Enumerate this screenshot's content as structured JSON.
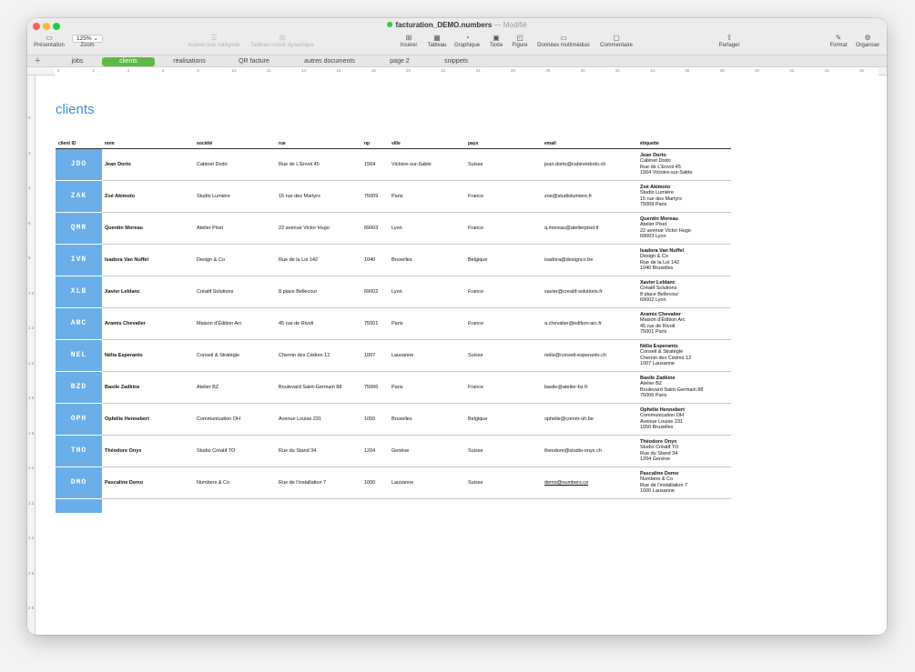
{
  "window": {
    "title": "facturation_DEMO.numbers",
    "modified": "— Modifié"
  },
  "toolbar": {
    "left": [
      {
        "label": "Présentation",
        "icon": "sidebar-icon"
      },
      {
        "label": "Zoom",
        "value": "125%"
      }
    ],
    "center_disabled": [
      {
        "label": "Insérer une catégorie",
        "icon": "list-icon"
      },
      {
        "label": "Tableau croisé dynamique",
        "icon": "pivot-icon"
      }
    ],
    "center": [
      {
        "label": "Insérer",
        "icon": "plus-box-icon"
      },
      {
        "label": "Tableau",
        "icon": "table-icon"
      },
      {
        "label": "Graphique",
        "icon": "chart-icon"
      },
      {
        "label": "Texte",
        "icon": "text-box-icon"
      },
      {
        "label": "Figure",
        "icon": "shape-icon"
      },
      {
        "label": "Données multimédias",
        "icon": "media-icon"
      },
      {
        "label": "Commentaire",
        "icon": "comment-icon"
      }
    ],
    "share": {
      "label": "Partager",
      "icon": "share-icon"
    },
    "right": [
      {
        "label": "Format",
        "icon": "brush-icon"
      },
      {
        "label": "Organiser",
        "icon": "organize-icon"
      }
    ]
  },
  "tabs": [
    "jobs",
    "clients",
    "réalisations",
    "QR facture",
    "autres documents",
    "page 2",
    "snippets"
  ],
  "active_tab": "clients",
  "ruler": [
    "0",
    "2",
    "4",
    "6",
    "8",
    "10",
    "12",
    "14",
    "16",
    "18",
    "20",
    "22",
    "24",
    "26",
    "28",
    "30",
    "32",
    "34",
    "36",
    "38",
    "40",
    "42",
    "44",
    "46"
  ],
  "vruler": [
    "0",
    "2",
    "4",
    "6",
    "8",
    "1 0",
    "1 2",
    "1 4",
    "1 6",
    "1 8",
    "2 0",
    "2 2",
    "2 4",
    "2 6",
    "2 8",
    "3"
  ],
  "sheet": {
    "title": "clients",
    "columns": [
      "client ID",
      "nom",
      "société",
      "rue",
      "np",
      "ville",
      "pays",
      "email",
      "étiquette"
    ],
    "rows": [
      {
        "id": "JDO",
        "nom": "Jean Dorto",
        "societe": "Cabinet Dodo",
        "rue": "Rue de L'Envol 45",
        "np": "1564",
        "ville": "Victoire-sur-Sable",
        "pays": "Suisse",
        "email": "jean.dorto@cabinetdodo.ch",
        "etiquette": [
          "Jean Dorto",
          "Cabinet Dodo",
          "Rue de L'Envol 45",
          "1564 Victoire-sur-Sable"
        ]
      },
      {
        "id": "ZAK",
        "nom": "Zoé Akimoto",
        "societe": "Studio Lumière",
        "rue": "15 rue des Martyrs",
        "np": "75009",
        "ville": "Paris",
        "pays": "France",
        "email": "zoe@studiolumiere.fr",
        "etiquette": [
          "Zoé Akimoto",
          "Studio Lumière",
          "15 rue des Martyrs",
          "75009 Paris"
        ]
      },
      {
        "id": "QMR",
        "nom": "Quentin Moreau",
        "societe": "Atelier Pixel",
        "rue": "22 avenue Victor Hugo",
        "np": "69003",
        "ville": "Lyon",
        "pays": "France",
        "email": "q.moreau@atelierpixel.fr",
        "etiquette": [
          "Quentin Moreau",
          "Atelier Pixel",
          "22 avenue Victor Hugo",
          "69003 Lyon"
        ]
      },
      {
        "id": "IVN",
        "nom": "Isadora Van Nuffel",
        "societe": "Design & Co",
        "rue": "Rue de la Loi 142",
        "np": "1040",
        "ville": "Bruxelles",
        "pays": "Belgique",
        "email": "isadora@designco.be",
        "etiquette": [
          "Isadora Van Nuffel",
          "Design & Co",
          "Rue de la Loi 142",
          "1040 Bruxelles"
        ]
      },
      {
        "id": "XLB",
        "nom": "Xavier Leblanc",
        "societe": "Créatif Solutions",
        "rue": "8 place Bellecour",
        "np": "69002",
        "ville": "Lyon",
        "pays": "France",
        "email": "xavier@creatif-solutions.fr",
        "etiquette": [
          "Xavier Leblanc",
          "Créatif Solutions",
          "8 place Bellecour",
          "69002 Lyon"
        ]
      },
      {
        "id": "ARC",
        "nom": "Aramis Chevalier",
        "societe": "Maison d'Édition Arc",
        "rue": "45 rue de Rivoli",
        "np": "75001",
        "ville": "Paris",
        "pays": "France",
        "email": "a.chevalier@edition-arc.fr",
        "etiquette": [
          "Aramis Chevalier",
          "Maison d'Édition Arc",
          "45 rue de Rivoli",
          "75001 Paris"
        ]
      },
      {
        "id": "NEL",
        "nom": "Nélia Esperanto",
        "societe": "Conseil & Stratégie",
        "rue": "Chemin des Cèdres 12",
        "np": "1007",
        "ville": "Lausanne",
        "pays": "Suisse",
        "email": "nelia@conseil-esperanto.ch",
        "etiquette": [
          "Nélia Esperanto",
          "Conseil & Stratégie",
          "Chemin des Cèdres 12",
          "1007 Lausanne"
        ]
      },
      {
        "id": "BZD",
        "nom": "Basile Zadkine",
        "societe": "Atelier BZ",
        "rue": "Boulevard Saint-Germain 88",
        "np": "75006",
        "ville": "Paris",
        "pays": "France",
        "email": "basile@atelier-bz.fr",
        "etiquette": [
          "Basile Zadkine",
          "Atelier BZ",
          "Boulevard Saint-Germain 88",
          "75006 Paris"
        ]
      },
      {
        "id": "OPH",
        "nom": "Ophélie Hennebert",
        "societe": "Communication OH",
        "rue": "Avenue Louise 231",
        "np": "1050",
        "ville": "Bruxelles",
        "pays": "Belgique",
        "email": "ophelie@comm-oh.be",
        "etiquette": [
          "Ophélie Hennebert",
          "Communication OH",
          "Avenue Louise 231",
          "1050 Bruxelles"
        ]
      },
      {
        "id": "THO",
        "nom": "Théodore Onyx",
        "societe": "Studio Créatif TO",
        "rue": "Rue du Stand 34",
        "np": "1204",
        "ville": "Genève",
        "pays": "Suisse",
        "email": "theodore@studio-onyx.ch",
        "etiquette": [
          "Théodore Onyx",
          "Studio Créatif TO",
          "Rue du Stand 34",
          "1204 Genève"
        ]
      },
      {
        "id": "DMO",
        "nom": "Pascaline Demo",
        "societe": "Numbers & Co",
        "rue": "Rue de l'installation 7",
        "np": "1000",
        "ville": "Lausanne",
        "pays": "Suisse",
        "email": "demo@numbers.co",
        "email_underlined": true,
        "etiquette": [
          "Pascaline Demo",
          "Numbers & Co",
          "Rue de l'installation 7",
          "1000 Lausanne"
        ]
      }
    ]
  },
  "colors": {
    "accent_tab": "#5fba45",
    "id_cell": "#6aaeea",
    "title": "#3b8fd9"
  }
}
